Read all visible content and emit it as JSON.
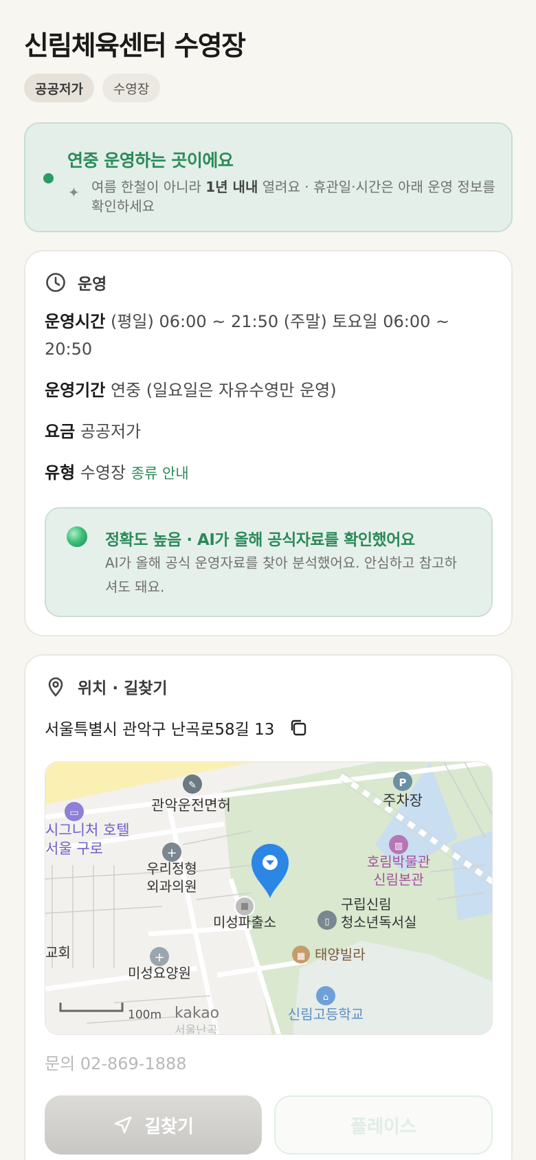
{
  "header": {
    "title": "신림체육센터 수영장",
    "tags": [
      "공공저가",
      "수영장"
    ]
  },
  "notice": {
    "title": "연중 운영하는 곳이에요",
    "icon": "sparkle-icon",
    "desc_before": "여름 한철이 아니라 ",
    "desc_bold": "1년 내내",
    "desc_after": " 열려요 · 휴관일·시간은 아래 운영 정보를 확인하세요"
  },
  "operation": {
    "heading": "운영",
    "hours_label": "운영시간",
    "hours_value": "(평일) 06:00 ~ 21:50 (주말) 토요일 06:00 ~ 20:50",
    "period_label": "운영기간",
    "period_value": "연중 (일요일은 자유수영만 운영)",
    "fee_label": "요금",
    "fee_value": "공공저가",
    "type_label": "유형",
    "type_value": "수영장",
    "type_link": "종류 안내",
    "ai_title": "정확도 높음 · AI가 올해 공식자료를 확인했어요",
    "ai_desc": "AI가 올해 공식 운영자료를 찾아 분석했어요. 안심하고 참고하셔도 돼요."
  },
  "location": {
    "heading": "위치 · 길찾기",
    "address": "서울특별시 관악구 난곡로58길 13",
    "map_labels": {
      "driving_school": "관악운전면허",
      "hotel_1": "시그니처 호텔",
      "hotel_2": "서울 구로",
      "clinic_1": "우리정형",
      "clinic_2": "외과의원",
      "police": "미성파출소",
      "parking": "주차장",
      "museum_1": "호림박물관",
      "museum_2": "신림본관",
      "library_1": "구립신림",
      "library_2": "청소년독서실",
      "villa": "태양빌라",
      "church": "교회",
      "care_home": "미성요양원",
      "school": "신림고등학교",
      "scale": "100m",
      "kakao": "kakao",
      "top_partial": "서울난곡"
    },
    "phone": "문의 02-869-1888",
    "route_button": "길찾기",
    "place_button": "플레이스"
  },
  "colors": {
    "accent_green": "#2a8a58",
    "map_pin": "#2b86e6",
    "map_park": "#d9e8cf",
    "map_road_yellow": "#faf0b4"
  }
}
